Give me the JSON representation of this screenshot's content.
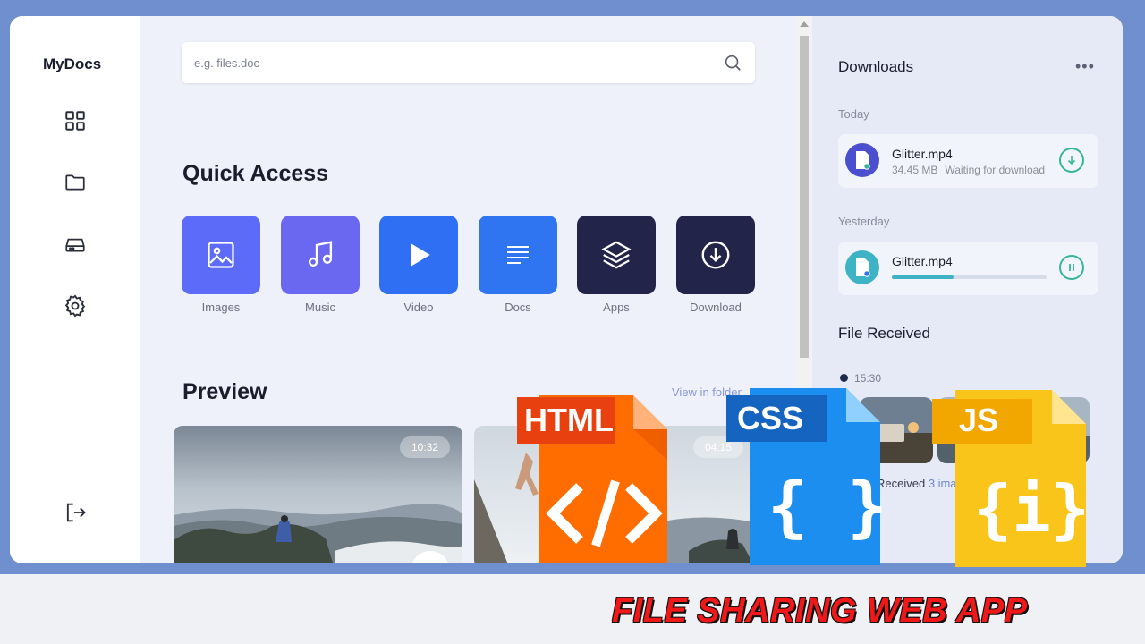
{
  "app": {
    "brand": "MyDocs"
  },
  "nav": {
    "items": [
      {
        "name": "dashboard-icon"
      },
      {
        "name": "folder-icon"
      },
      {
        "name": "drive-icon"
      },
      {
        "name": "settings-icon"
      }
    ],
    "logout": {
      "name": "logout-icon"
    }
  },
  "search": {
    "placeholder": "e.g. files.doc",
    "value": ""
  },
  "quick_access": {
    "title": "Quick Access",
    "items": [
      {
        "label": "Images",
        "icon": "image-icon",
        "color": "#5c6cf8"
      },
      {
        "label": "Music",
        "icon": "music-icon",
        "color": "#6a68f0"
      },
      {
        "label": "Video",
        "icon": "play-icon",
        "color": "#2f6ff3"
      },
      {
        "label": "Docs",
        "icon": "document-icon",
        "color": "#2f74f0"
      },
      {
        "label": "Apps",
        "icon": "layers-icon",
        "color": "#23244a"
      },
      {
        "label": "Download",
        "icon": "download-icon",
        "color": "#23244a"
      }
    ]
  },
  "preview": {
    "title": "Preview",
    "view_link": "View in folder",
    "videos": [
      {
        "duration": "10:32"
      },
      {
        "duration": "04:15"
      }
    ]
  },
  "downloads": {
    "title": "Downloads",
    "more_label": "•••",
    "groups": [
      {
        "label": "Today",
        "file": {
          "name": "Glitter.mp4",
          "size": "34.45 MB",
          "status": "Waiting for download",
          "action": "download"
        }
      },
      {
        "label": "Yesterday",
        "file": {
          "name": "Glitter.mp4",
          "progress": 0.4,
          "action": "pause"
        }
      }
    ]
  },
  "file_received": {
    "title": "File Received",
    "time": "15:30",
    "text": "Received",
    "count": "3 images"
  },
  "overlay": {
    "html_label": "HTML",
    "css_label": "CSS",
    "js_label": "JS",
    "caption": "FILE SHARING WEB APP"
  },
  "colors": {
    "accent": "#36b59a",
    "progress": "#3fb3c6",
    "caption": "#f01818"
  }
}
